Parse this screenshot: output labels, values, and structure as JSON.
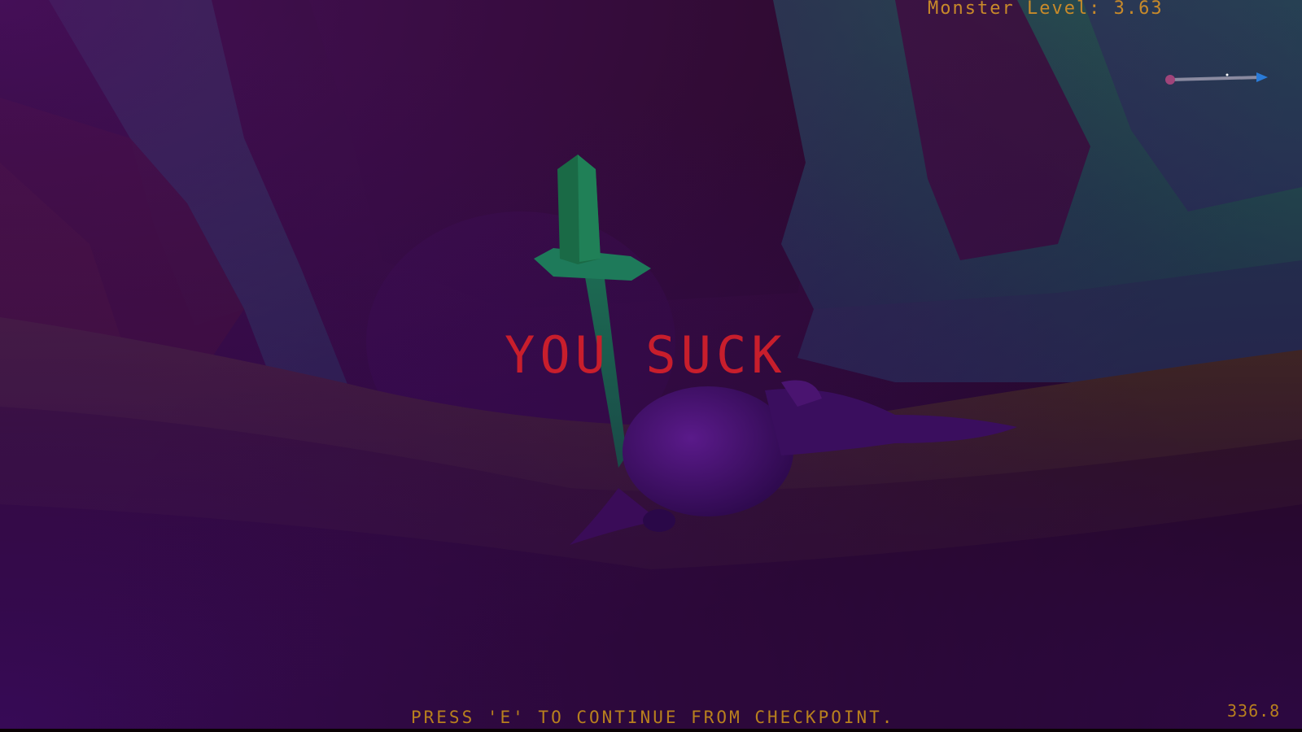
{
  "hud": {
    "monster_level": "Monster Level: 3.63",
    "fps": "336.8"
  },
  "death_screen": {
    "title": "YOU SUCK",
    "prompt": "PRESS 'E' TO CONTINUE FROM CHECKPOINT."
  },
  "colors": {
    "hud_text": "#c88a2a",
    "death_title": "#c81e2c",
    "compass_start": "#a0447a",
    "compass_end": "#2a7bd8"
  },
  "compass": {
    "start_icon": "dot-icon",
    "end_icon": "arrow-icon"
  }
}
